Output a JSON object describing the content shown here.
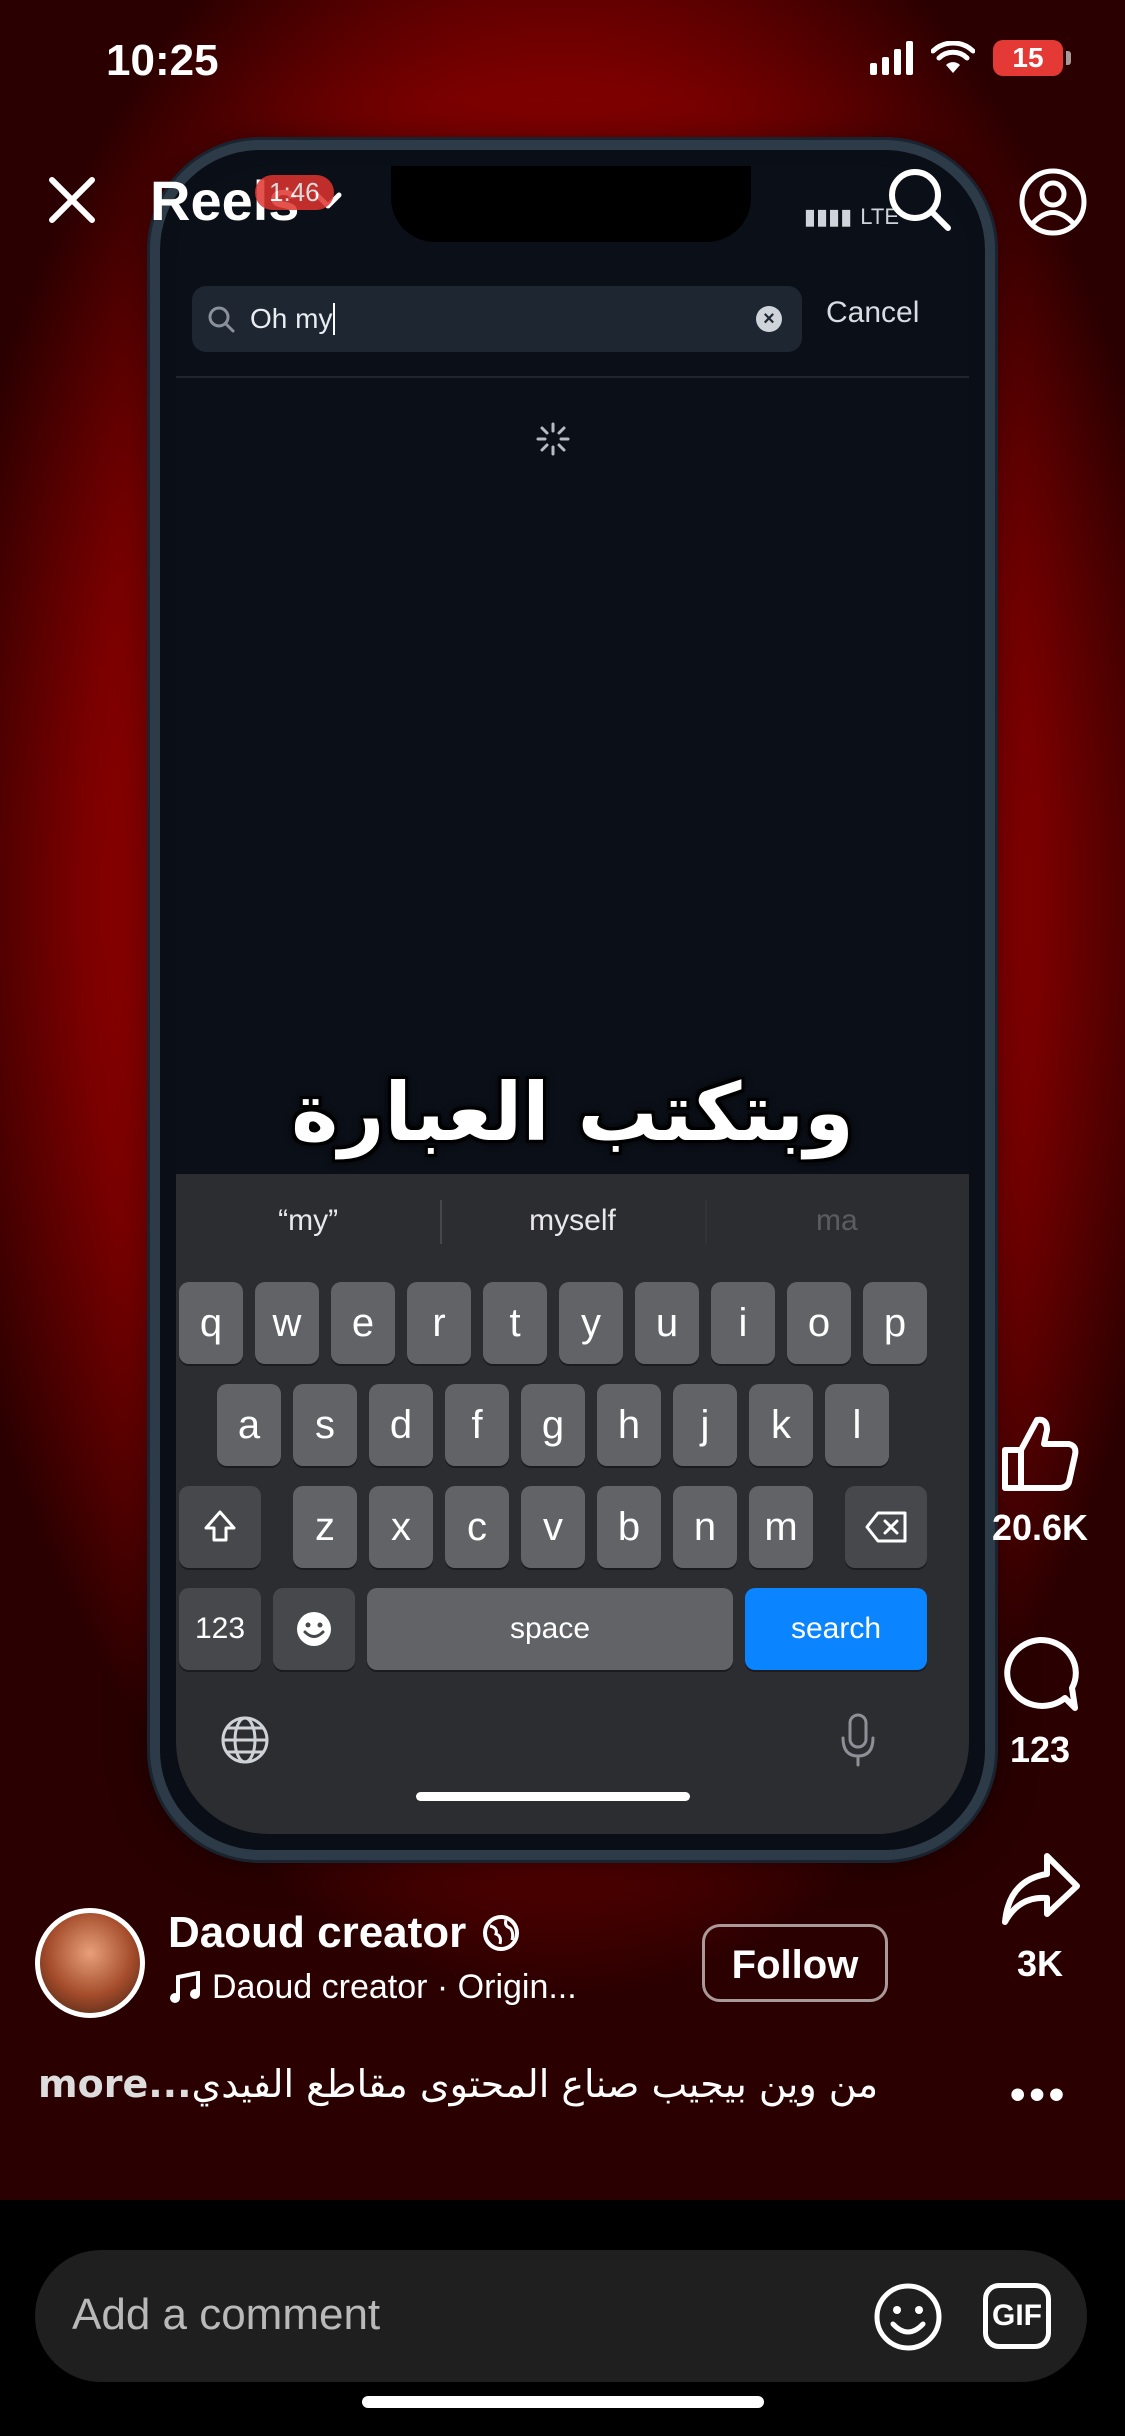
{
  "status_bar": {
    "time": "10:25",
    "battery": "15"
  },
  "header": {
    "title": "Reels",
    "badge": "1:46"
  },
  "inner_screen": {
    "status": "LTE",
    "search_query": "Oh my",
    "cancel_label": "Cancel",
    "caption_arabic": "وبتكتب العبارة",
    "suggestions": [
      "“my”",
      "myself",
      "ma"
    ],
    "keyboard": {
      "row1": [
        "q",
        "w",
        "e",
        "r",
        "t",
        "y",
        "u",
        "i",
        "o",
        "p"
      ],
      "row2": [
        "a",
        "s",
        "d",
        "f",
        "g",
        "h",
        "j",
        "k",
        "l"
      ],
      "row3": [
        "z",
        "x",
        "c",
        "v",
        "b",
        "n",
        "m"
      ],
      "numbers_label": "123",
      "space_label": "space",
      "search_label": "search"
    }
  },
  "rail": {
    "likes": "20.6K",
    "comments": "123",
    "shares": "3K"
  },
  "author": {
    "name": "Daoud creator",
    "audio": "Daoud creator · Origin...",
    "follow_label": "Follow"
  },
  "caption": {
    "text": "من وين بيجيب صناع المحتوى مقاطع الفيدي",
    "more": "...more"
  },
  "comment_bar": {
    "placeholder": "Add a comment",
    "gif_label": "GIF"
  },
  "icons": [
    "close-icon",
    "chevron-down-icon",
    "search-icon",
    "profile-icon",
    "like-icon",
    "comment-icon",
    "share-icon",
    "music-icon",
    "globe-icon",
    "emoji-icon",
    "gif-icon",
    "more-icon"
  ]
}
